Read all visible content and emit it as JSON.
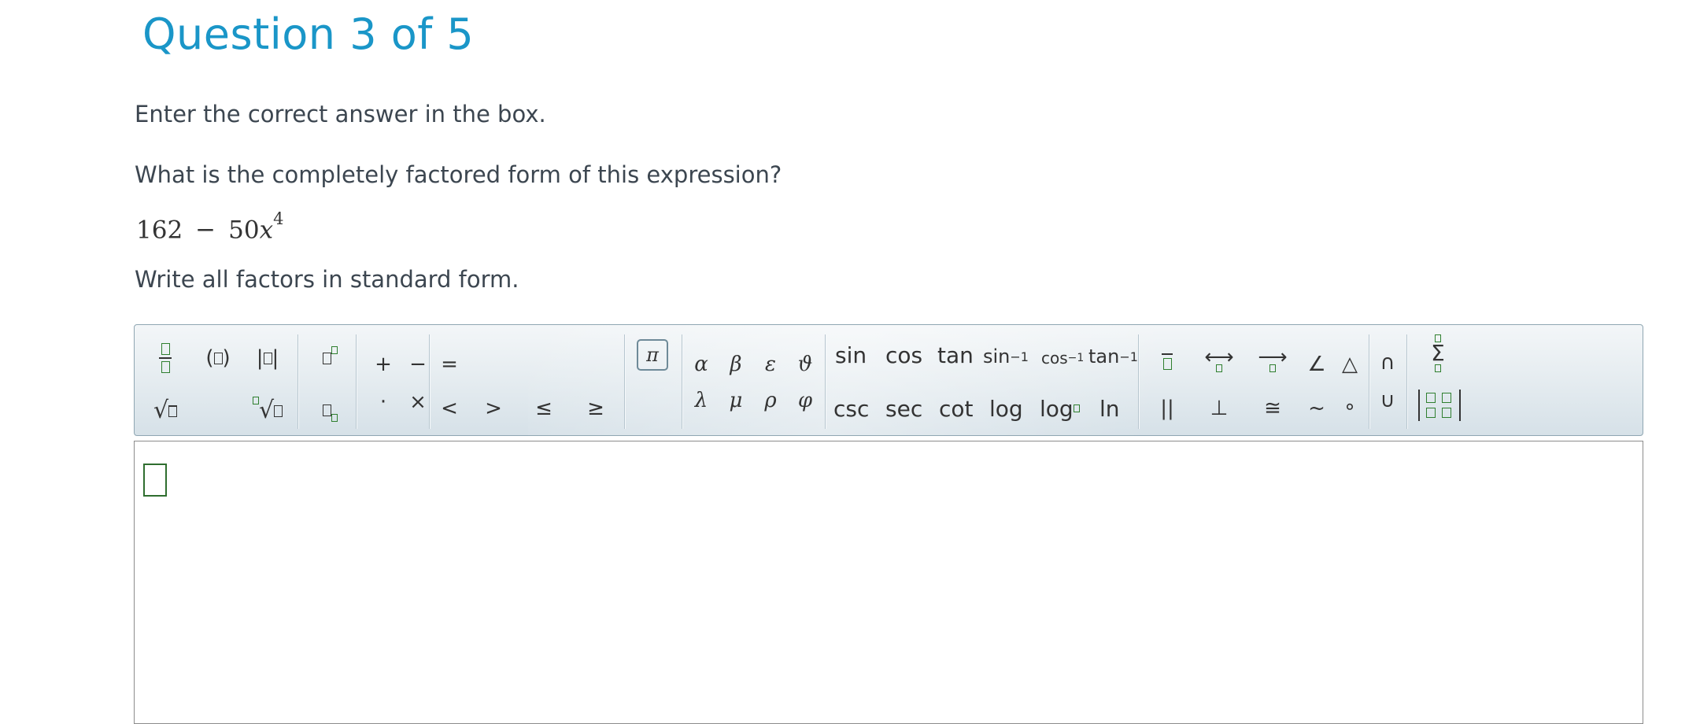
{
  "question": {
    "title": "Question 3 of 5",
    "instruction": "Enter the correct answer in the box.",
    "prompt": "What is the completely factored form of this expression?",
    "expression": {
      "constant": "162",
      "operator": "−",
      "coefficient": "50",
      "variable": "x",
      "exponent": "4"
    },
    "note": "Write all factors in standard form."
  },
  "toolbar": {
    "structures": [
      "fraction",
      "parentheses",
      "absolute-value",
      "superscript",
      "square-root",
      "nth-root",
      "subscript"
    ],
    "operators": {
      "plus": "+",
      "minus": "−",
      "dot": "·",
      "times": "×"
    },
    "relations": {
      "equals": "=",
      "less": "<",
      "greater": ">",
      "leq": "≤",
      "geq": "≥"
    },
    "constants": {
      "pi": "π"
    },
    "greek": {
      "alpha": "α",
      "beta": "β",
      "epsilon": "ε",
      "theta": "ϑ",
      "lambda": "λ",
      "mu": "μ",
      "rho": "ρ",
      "phi": "φ"
    },
    "trig": {
      "sin": "sin",
      "cos": "cos",
      "tan": "tan",
      "arcsin": "sin",
      "arccos": "cos",
      "arctan": "tan",
      "inverse": "−1",
      "csc": "csc",
      "sec": "sec",
      "cot": "cot",
      "log": "log",
      "logb": "log",
      "ln": "ln"
    },
    "geometry": {
      "parallel": "||",
      "perp": "⊥",
      "congruent": "≅",
      "similar": "~",
      "degree": "∘",
      "angle": "∠",
      "triangle": "△",
      "line": "⟷",
      "ray": "⟶"
    },
    "sets": {
      "intersection": "∩",
      "union": "∪",
      "sum": "Σ"
    }
  },
  "colors": {
    "title": "#1a96c8",
    "placeholder": "#2f7f2f",
    "toolbar_border": "#8fa6b2"
  }
}
